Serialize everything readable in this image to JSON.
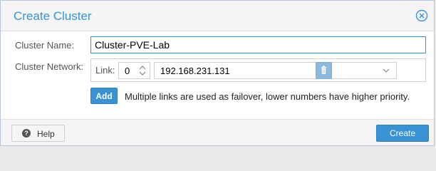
{
  "dialog": {
    "title": "Create Cluster"
  },
  "form": {
    "cluster_name_label": "Cluster Name:",
    "cluster_name_value": "Cluster-PVE-Lab",
    "cluster_network_label": "Cluster Network:",
    "link_label": "Link:",
    "link_number": "0",
    "link_address": "192.168.231.131",
    "add_label": "Add",
    "hint": "Multiple links are used as failover, lower numbers have higher priority."
  },
  "footer": {
    "help_label": "Help",
    "create_label": "Create"
  },
  "icons": {
    "close": "close-circle-icon",
    "spinner": "spinner-arrows-icon",
    "dropdown": "chevron-down-icon",
    "delete": "trash-icon",
    "help": "question-icon"
  },
  "colors": {
    "accent": "#3892d4",
    "disabled_button": "#8bb9e0"
  }
}
